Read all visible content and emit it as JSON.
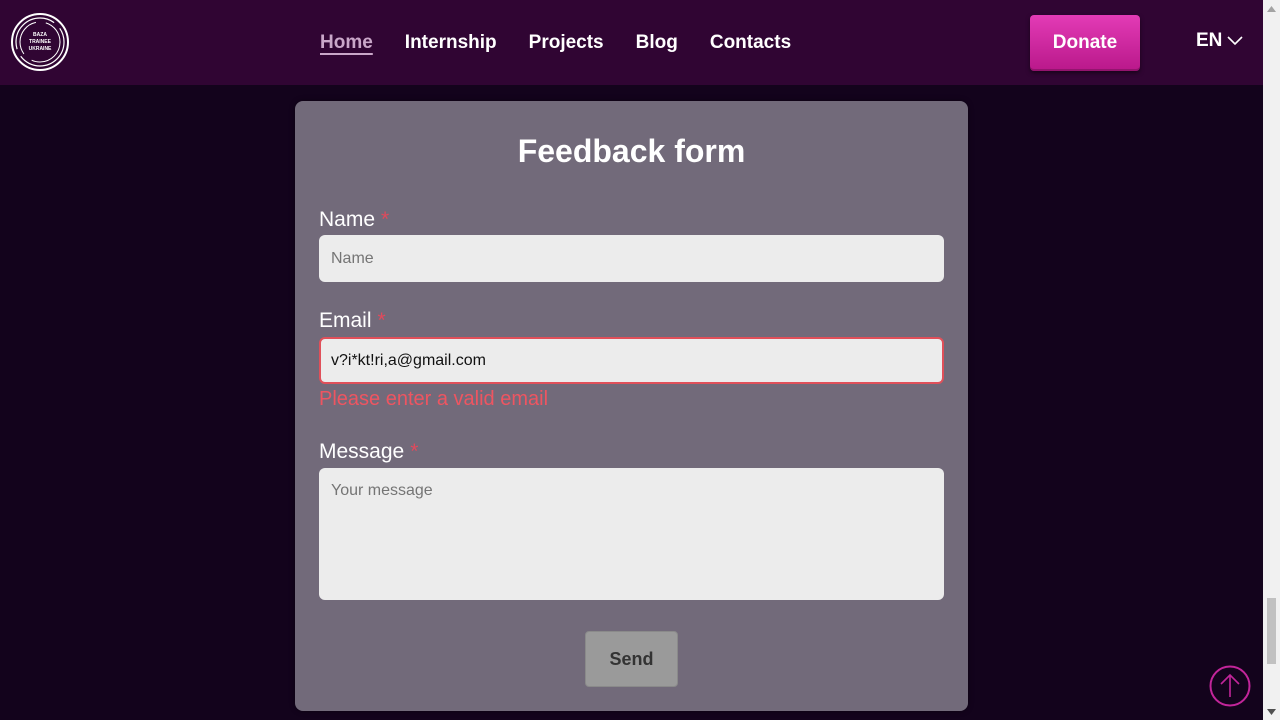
{
  "header": {
    "logo_lines": [
      "BAZA",
      "TRAINEE",
      "UKRAINE"
    ],
    "nav": [
      {
        "label": "Home",
        "active": true
      },
      {
        "label": "Internship",
        "active": false
      },
      {
        "label": "Projects",
        "active": false
      },
      {
        "label": "Blog",
        "active": false
      },
      {
        "label": "Contacts",
        "active": false
      }
    ],
    "donate_label": "Donate",
    "language": "EN"
  },
  "form": {
    "title": "Feedback form",
    "required_mark": "*",
    "name": {
      "label": "Name",
      "placeholder": "Name",
      "value": ""
    },
    "email": {
      "label": "Email",
      "placeholder": "",
      "value": "v?i*kt!ri,a@gmail.com",
      "error": "Please enter a valid email"
    },
    "message": {
      "label": "Message",
      "placeholder": "Your message",
      "value": ""
    },
    "send_label": "Send"
  },
  "colors": {
    "header_bg": "#300533",
    "page_bg": "#13031c",
    "card_bg": "#726a7a",
    "donate": "#d62aa3",
    "error": "#ee5561",
    "accent_scroll": "#c2259a"
  },
  "icons": {
    "lang_chevron": "chevron-down-icon",
    "scroll_top": "arrow-up-icon"
  }
}
